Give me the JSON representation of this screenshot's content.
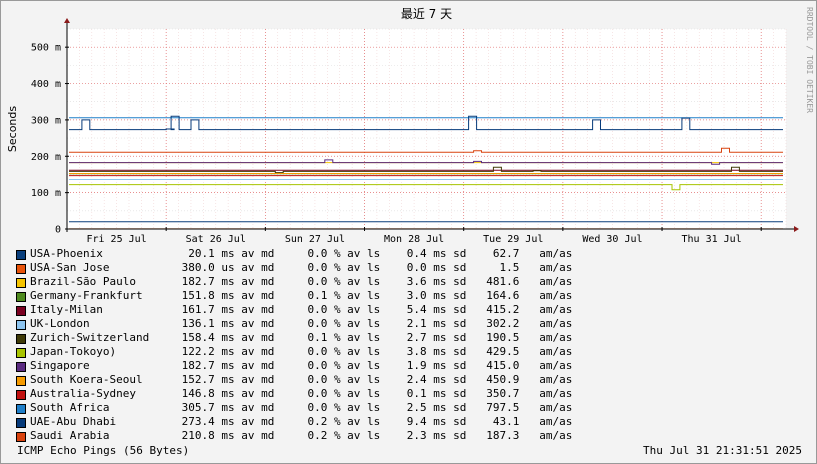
{
  "chart_data": {
    "type": "line",
    "title": "最近 7 天",
    "ylabel": "Seconds",
    "side_text": "RRDTOOL / TOBI OETIKER",
    "ylim": [
      0,
      0.55
    ],
    "yticks": [
      {
        "v": 0,
        "label": "0"
      },
      {
        "v": 0.1,
        "label": "100 m"
      },
      {
        "v": 0.2,
        "label": "200 m"
      },
      {
        "v": 0.3,
        "label": "300 m"
      },
      {
        "v": 0.4,
        "label": "400 m"
      },
      {
        "v": 0.5,
        "label": "500 m"
      }
    ],
    "xlim": [
      0,
      7.25
    ],
    "xticks": [
      {
        "v": 0.5,
        "label": "Fri 25 Jul"
      },
      {
        "v": 1.5,
        "label": "Sat 26 Jul"
      },
      {
        "v": 2.5,
        "label": "Sun 27 Jul"
      },
      {
        "v": 3.5,
        "label": "Mon 28 Jul"
      },
      {
        "v": 4.5,
        "label": "Tue 29 Jul"
      },
      {
        "v": 5.5,
        "label": "Wed 30 Jul"
      },
      {
        "v": 6.5,
        "label": "Thu 31 Jul"
      }
    ],
    "series": [
      {
        "name": "USA-Phoenix",
        "color": "#0a3f7c",
        "y": 0.0201,
        "stats": {
          "median": "20.1 ms",
          "loss": "0.0 %",
          "sd": "0.4 ms",
          "ratio": "62.7"
        },
        "events": []
      },
      {
        "name": "USA-San Jose",
        "color": "#e8530a",
        "y": 0.00038,
        "stats": {
          "median": "380.0 us",
          "loss": "0.0 %",
          "sd": "0.0 ms",
          "ratio": "1.5"
        },
        "events": []
      },
      {
        "name": "Brazil-São Paulo",
        "color": "#f5c400",
        "y": 0.1827,
        "stats": {
          "median": "182.7 ms",
          "loss": "0.0 %",
          "sd": "3.6 ms",
          "ratio": "481.6"
        },
        "events": []
      },
      {
        "name": "Germany-Frankfurt",
        "color": "#4e8a1e",
        "y": 0.1518,
        "stats": {
          "median": "151.8 ms",
          "loss": "0.1 %",
          "sd": "3.0 ms",
          "ratio": "164.6"
        },
        "events": []
      },
      {
        "name": "Italy-Milan",
        "color": "#7a0020",
        "y": 0.1617,
        "stats": {
          "median": "161.7 ms",
          "loss": "0.0 %",
          "sd": "5.4 ms",
          "ratio": "415.2"
        },
        "events": []
      },
      {
        "name": "UK-London",
        "color": "#8ec5f0",
        "y": 0.1361,
        "stats": {
          "median": "136.1 ms",
          "loss": "0.0 %",
          "sd": "2.1 ms",
          "ratio": "302.2"
        },
        "events": []
      },
      {
        "name": "Zurich-Switzerland",
        "color": "#3f3a07",
        "y": 0.1584,
        "stats": {
          "median": "158.4 ms",
          "loss": "0.1 %",
          "sd": "2.7 ms",
          "ratio": "190.5"
        },
        "events": [
          [
            2.1,
            0.155
          ],
          [
            4.3,
            0.17
          ],
          [
            4.7,
            0.16
          ],
          [
            6.7,
            0.17
          ]
        ]
      },
      {
        "name": "Japan-Tokoyo)",
        "color": "#a8c400",
        "y": 0.1222,
        "stats": {
          "median": "122.2 ms",
          "loss": "0.0 %",
          "sd": "3.8 ms",
          "ratio": "429.5"
        },
        "events": [
          [
            6.1,
            0.108
          ]
        ]
      },
      {
        "name": "Singapore",
        "color": "#5a2a80",
        "y": 0.1827,
        "stats": {
          "median": "182.7 ms",
          "loss": "0.0 %",
          "sd": "1.9 ms",
          "ratio": "415.0"
        },
        "events": [
          [
            2.6,
            0.19
          ],
          [
            4.1,
            0.186
          ],
          [
            6.5,
            0.178
          ]
        ]
      },
      {
        "name": "South Koera-Seoul",
        "color": "#f59a00",
        "y": 0.1527,
        "stats": {
          "median": "152.7 ms",
          "loss": "0.0 %",
          "sd": "2.4 ms",
          "ratio": "450.9"
        },
        "events": []
      },
      {
        "name": "Australia-Sydney",
        "color": "#c0100f",
        "y": 0.1468,
        "stats": {
          "median": "146.8 ms",
          "loss": "0.0 %",
          "sd": "0.1 ms",
          "ratio": "350.7"
        },
        "events": []
      },
      {
        "name": "South Africa",
        "color": "#1e7ec8",
        "y": 0.3057,
        "stats": {
          "median": "305.7 ms",
          "loss": "0.0 %",
          "sd": "2.5 ms",
          "ratio": "797.5"
        },
        "events": []
      },
      {
        "name": "UAE-Abu Dhabi",
        "color": "#063a7a",
        "y": 0.2734,
        "stats": {
          "median": "273.4 ms",
          "loss": "0.2 %",
          "sd": "9.4 ms",
          "ratio": "43.1"
        },
        "events": [
          [
            0.15,
            0.3
          ],
          [
            1.0,
            0.275
          ],
          [
            1.05,
            0.31
          ],
          [
            1.25,
            0.3
          ],
          [
            4.05,
            0.31
          ],
          [
            5.3,
            0.3
          ],
          [
            6.2,
            0.305
          ]
        ]
      },
      {
        "name": "Saudi Arabia",
        "color": "#d9420e",
        "y": 0.2108,
        "stats": {
          "median": "210.8 ms",
          "loss": "0.2 %",
          "sd": "2.3 ms",
          "ratio": "187.3"
        },
        "events": [
          [
            4.1,
            0.215
          ],
          [
            6.6,
            0.222
          ]
        ]
      }
    ],
    "stat_units": {
      "median": "av md",
      "loss": "av ls",
      "sd": "sd",
      "ratio": "am/as"
    },
    "footer_left": "ICMP Echo Pings (56 Bytes)",
    "footer_right": "Thu Jul 31 21:31:51 2025",
    "grid": true,
    "legend_position": "bottom-left"
  }
}
